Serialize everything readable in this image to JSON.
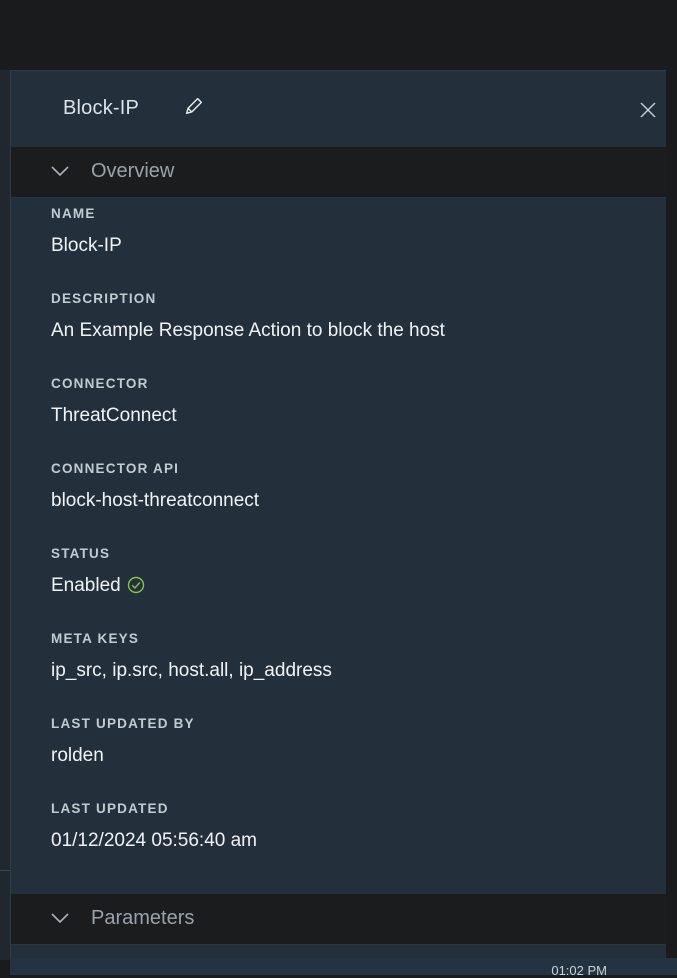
{
  "panel": {
    "title": "Block-IP"
  },
  "sections": {
    "overview_label": "Overview",
    "parameters_label": "Parameters"
  },
  "fields": [
    {
      "label": "NAME",
      "value": "Block-IP"
    },
    {
      "label": "DESCRIPTION",
      "value": "An Example Response Action to block the host"
    },
    {
      "label": "CONNECTOR",
      "value": "ThreatConnect"
    },
    {
      "label": "CONNECTOR API",
      "value": "block-host-threatconnect"
    },
    {
      "label": "STATUS",
      "value": "Enabled"
    },
    {
      "label": "META KEYS",
      "value": "ip_src, ip.src, host.all, ip_address"
    },
    {
      "label": "LAST UPDATED BY",
      "value": "rolden"
    },
    {
      "label": "LAST UPDATED",
      "value": "01/12/2024 05:56:40 am"
    }
  ],
  "bottom_bar": {
    "time": "01:02 PM"
  },
  "icons": {
    "edit": "pencil-icon",
    "close": "close-icon",
    "chevron": "chevron-down-icon",
    "status": "check-circle-icon"
  },
  "colors": {
    "panel_bg": "#23303b",
    "section_bar_bg": "#1b1c1e",
    "status_ok": "#8bc34a"
  }
}
